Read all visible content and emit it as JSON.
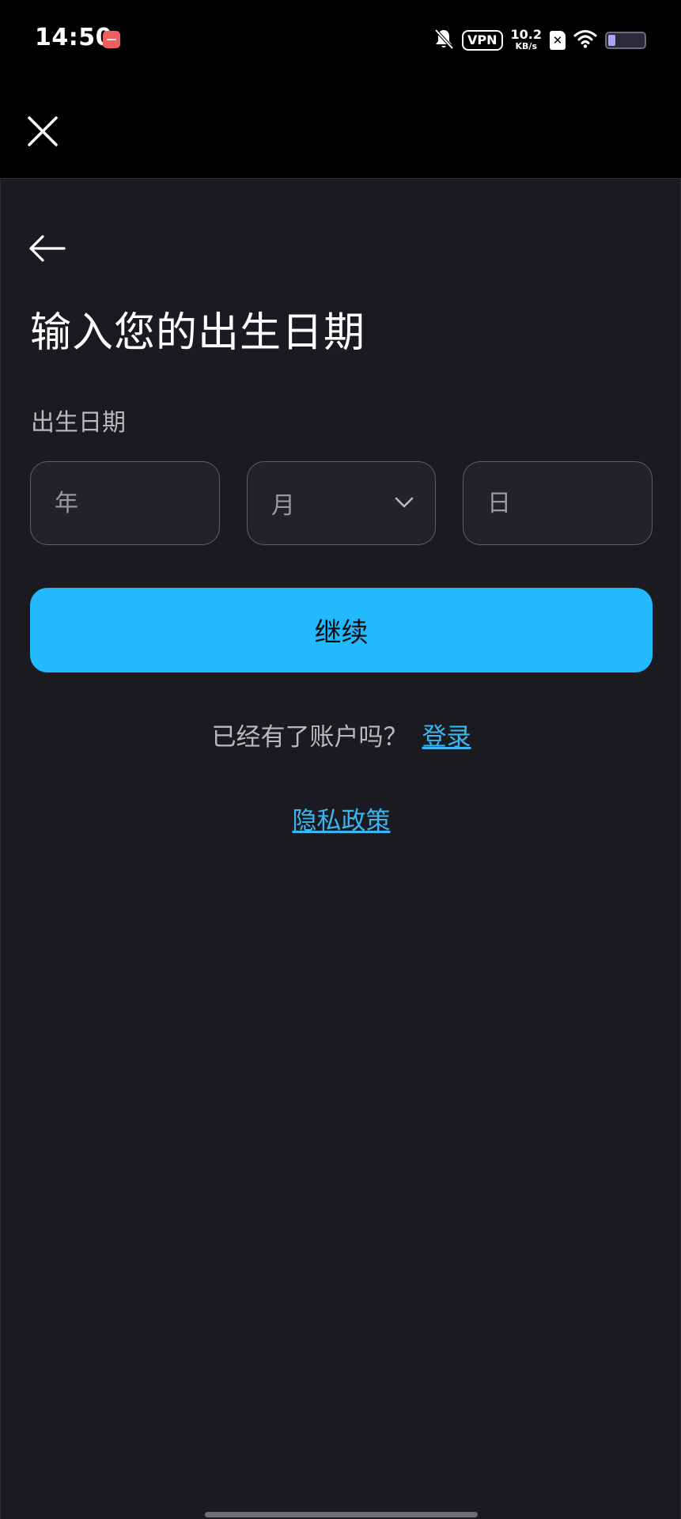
{
  "status_bar": {
    "time": "14:50",
    "vpn_label": "VPN",
    "net_speed_value": "10.2",
    "net_speed_unit": "KB/s",
    "battery_level": 0.2
  },
  "header": {
    "close_icon": "close-icon"
  },
  "form": {
    "back_icon": "arrow-left-icon",
    "title": "输入您的出生日期",
    "label": "出生日期",
    "year_placeholder": "年",
    "month_value": "月",
    "day_placeholder": "日",
    "continue_label": "继续"
  },
  "footer": {
    "have_account_text": "已经有了账户吗？",
    "login_label": "登录",
    "privacy_label": "隐私政策"
  },
  "colors": {
    "background": "#1b1a20",
    "accent": "#22b9fd",
    "link": "#38b6f1"
  }
}
